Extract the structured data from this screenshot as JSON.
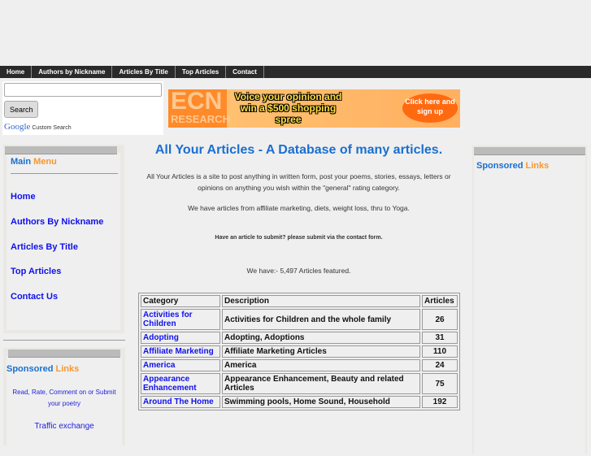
{
  "nav": [
    "Home",
    "Authors by Nickname",
    "Articles By Title",
    "Top Articles",
    "Contact"
  ],
  "search": {
    "button": "Search",
    "google": "Google",
    "custom": "Custom Search"
  },
  "banner": {
    "brand": "ECN",
    "brand_sub": "RESEARCH",
    "headline": "Voice your opinion and win a $500 shopping spree",
    "cta": "Click here and sign up"
  },
  "main_menu": {
    "title_a": "Main",
    "title_b": "Menu",
    "items": [
      "Home",
      "Authors By Nickname",
      "Articles By Title",
      "Top Articles",
      "Contact Us"
    ]
  },
  "sponsored": {
    "title_a": "Sponsored",
    "title_b": "Links",
    "links": [
      "Read, Rate, Comment on or Submit your poetry",
      "Traffic exchange"
    ]
  },
  "right": {
    "title_a": "Sponsored",
    "title_b": "Links"
  },
  "content": {
    "heading": "All Your Articles - A Database of many articles.",
    "intro": "All Your Articles is a site to post anything in written form, post your poems, stories, essays, letters or opinions on anything you wish within the \"general\" rating category.",
    "topics": "We have articles from affiliate marketing, diets, weight loss, thru to Yoga.",
    "submit": "Have an article to submit? please submit via the contact form.",
    "count": "We have:- 5,497 Articles featured."
  },
  "table": {
    "headers": [
      "Category",
      "Description",
      "Articles"
    ],
    "rows": [
      [
        "Activities for Children",
        "Activities for Children and the whole family",
        "26"
      ],
      [
        "Adopting",
        "Adopting, Adoptions",
        "31"
      ],
      [
        "Affiliate Marketing",
        "Affiliate Marketing Articles",
        "110"
      ],
      [
        "America",
        "America",
        "24"
      ],
      [
        "Appearance Enhancement",
        "Appearance Enhancement, Beauty and related Articles",
        "75"
      ],
      [
        "Around The Home",
        "Swimming pools, Home Sound, Household",
        "192"
      ]
    ]
  }
}
